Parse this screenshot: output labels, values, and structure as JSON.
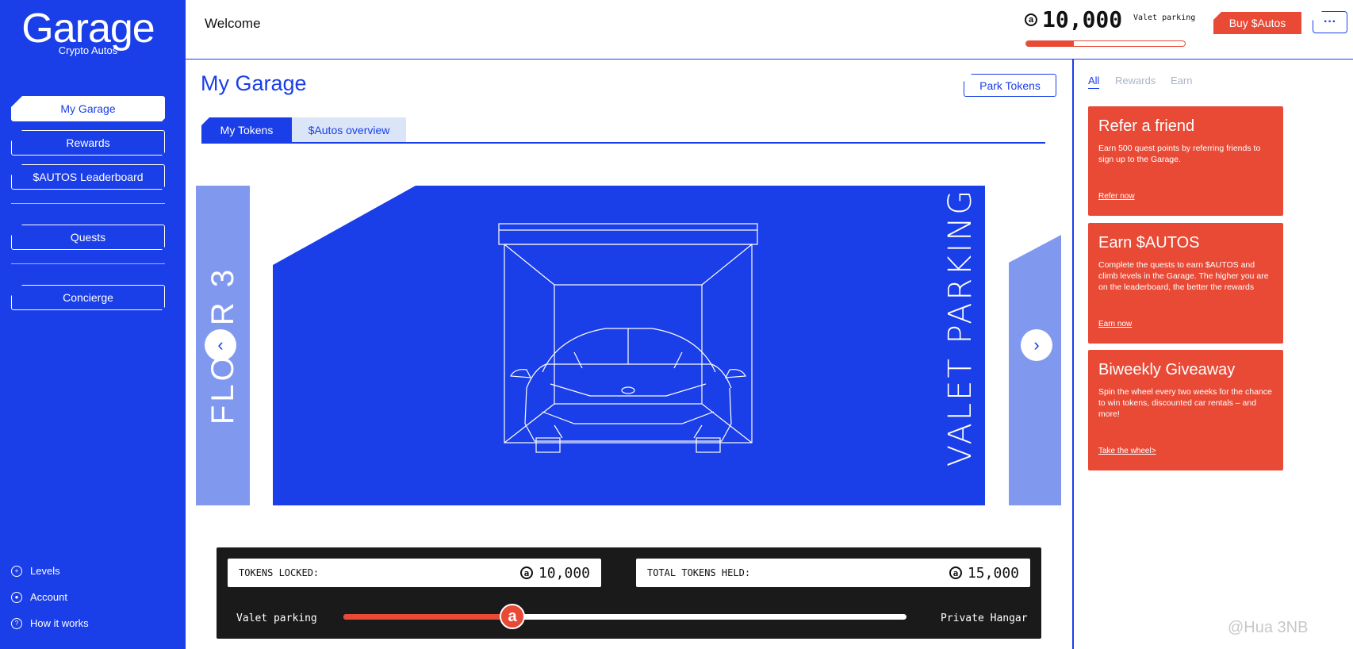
{
  "brand": {
    "title": "Garage",
    "subtitle": "Crypto Autos"
  },
  "sidebar": {
    "nav": [
      "My Garage",
      "Rewards",
      "$AUTOS Leaderboard",
      "Quests",
      "Concierge"
    ],
    "bottom_links": [
      {
        "label": "Levels",
        "icon": "plus-circle-icon"
      },
      {
        "label": "Account",
        "icon": "user-circle-icon"
      },
      {
        "label": "How it works",
        "icon": "question-circle-icon"
      }
    ]
  },
  "header": {
    "welcome": "Welcome",
    "balance": "10,000",
    "tier": "Valet parking",
    "tier_progress": 0.3,
    "buy_label": "Buy $Autos",
    "more_label": "···"
  },
  "main": {
    "title": "My Garage",
    "park_button": "Park Tokens",
    "tabs": [
      "My Tokens",
      "$Autos overview"
    ],
    "carousel": {
      "prev_card": "FLOOR 3",
      "current_card": "VALET PARKING"
    }
  },
  "tokens": {
    "locked_label": "TOKENS LOCKED:",
    "locked_value": "10,000",
    "held_label": "TOTAL TOKENS HELD:",
    "held_value": "15,000",
    "slider_start": "Valet parking",
    "slider_end": "Private Hangar",
    "slider_progress": 0.3
  },
  "rail": {
    "filters": [
      "All",
      "Rewards",
      "Earn"
    ],
    "cards": [
      {
        "title": "Refer a friend",
        "body": "Earn 500 quest points by referring friends to sign up to the Garage.",
        "link": "Refer now"
      },
      {
        "title": "Earn $AUTOS",
        "body": "Complete the quests to earn $AUTOS and climb levels in the Garage. The higher you are on the leaderboard, the better the rewards",
        "link": "Earn now"
      },
      {
        "title": "Biweekly Giveaway",
        "body": "Spin the wheel every two weeks for the chance to win tokens, discounted car rentals – and more!",
        "link": "Take the wheel>"
      }
    ]
  },
  "colors": {
    "brand_blue": "#1a3ee8",
    "accent_red": "#e84a36",
    "light_blue": "#8198ef"
  },
  "watermark": "@Hua 3NB"
}
